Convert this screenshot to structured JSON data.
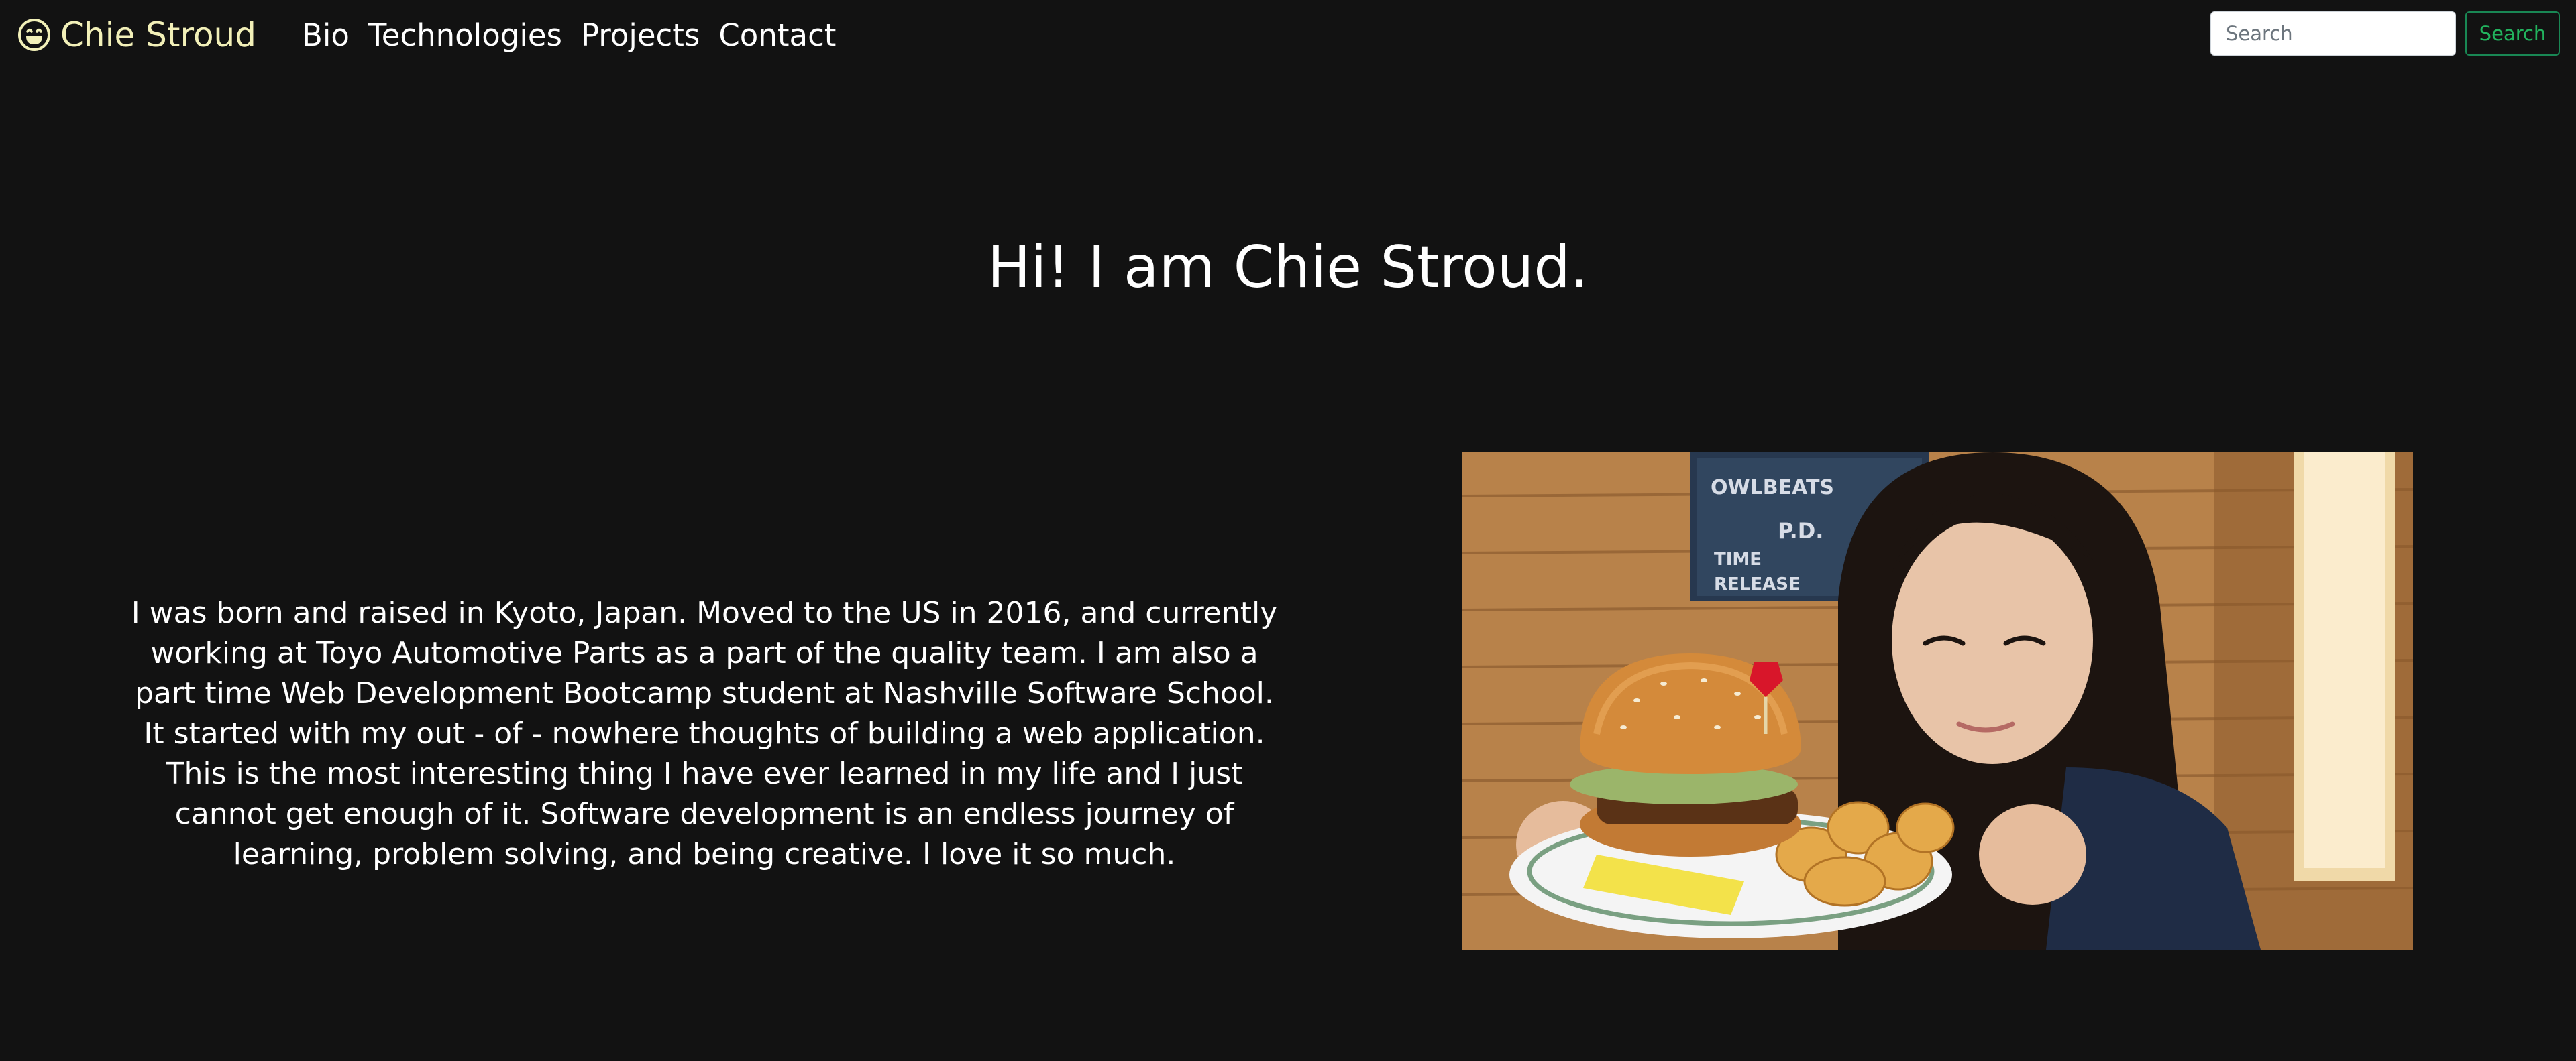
{
  "navbar": {
    "brand": "Chie Stroud",
    "brand_icon": "grinning-face-icon",
    "links": [
      "Bio",
      "Technologies",
      "Projects",
      "Contact"
    ],
    "search": {
      "placeholder": "Search",
      "value": "",
      "button_label": "Search"
    }
  },
  "hero": {
    "title": "Hi! I am Chie Stroud."
  },
  "bio": {
    "text": "I was born and raised in Kyoto, Japan. Moved to the US in 2016, and currently working at Toyo Automotive Parts as a part of the quality team. I am also a part time Web Development Bootcamp student at Nashville Software School. It started with my out - of - nowhere thoughts of building a web application. This is the most interesting thing I have ever learned in my life and I just cannot get enough of it. Software development is an endless journey of learning, problem solving, and being creative. I love it so much."
  },
  "photo": {
    "poster_lines": [
      "OWLBEATS",
      "P.D.",
      "TIME",
      "RELEASE"
    ]
  },
  "colors": {
    "background": "#121212",
    "brand": "#f2f0b8",
    "text": "#ffffff",
    "search_button": "#198754"
  }
}
